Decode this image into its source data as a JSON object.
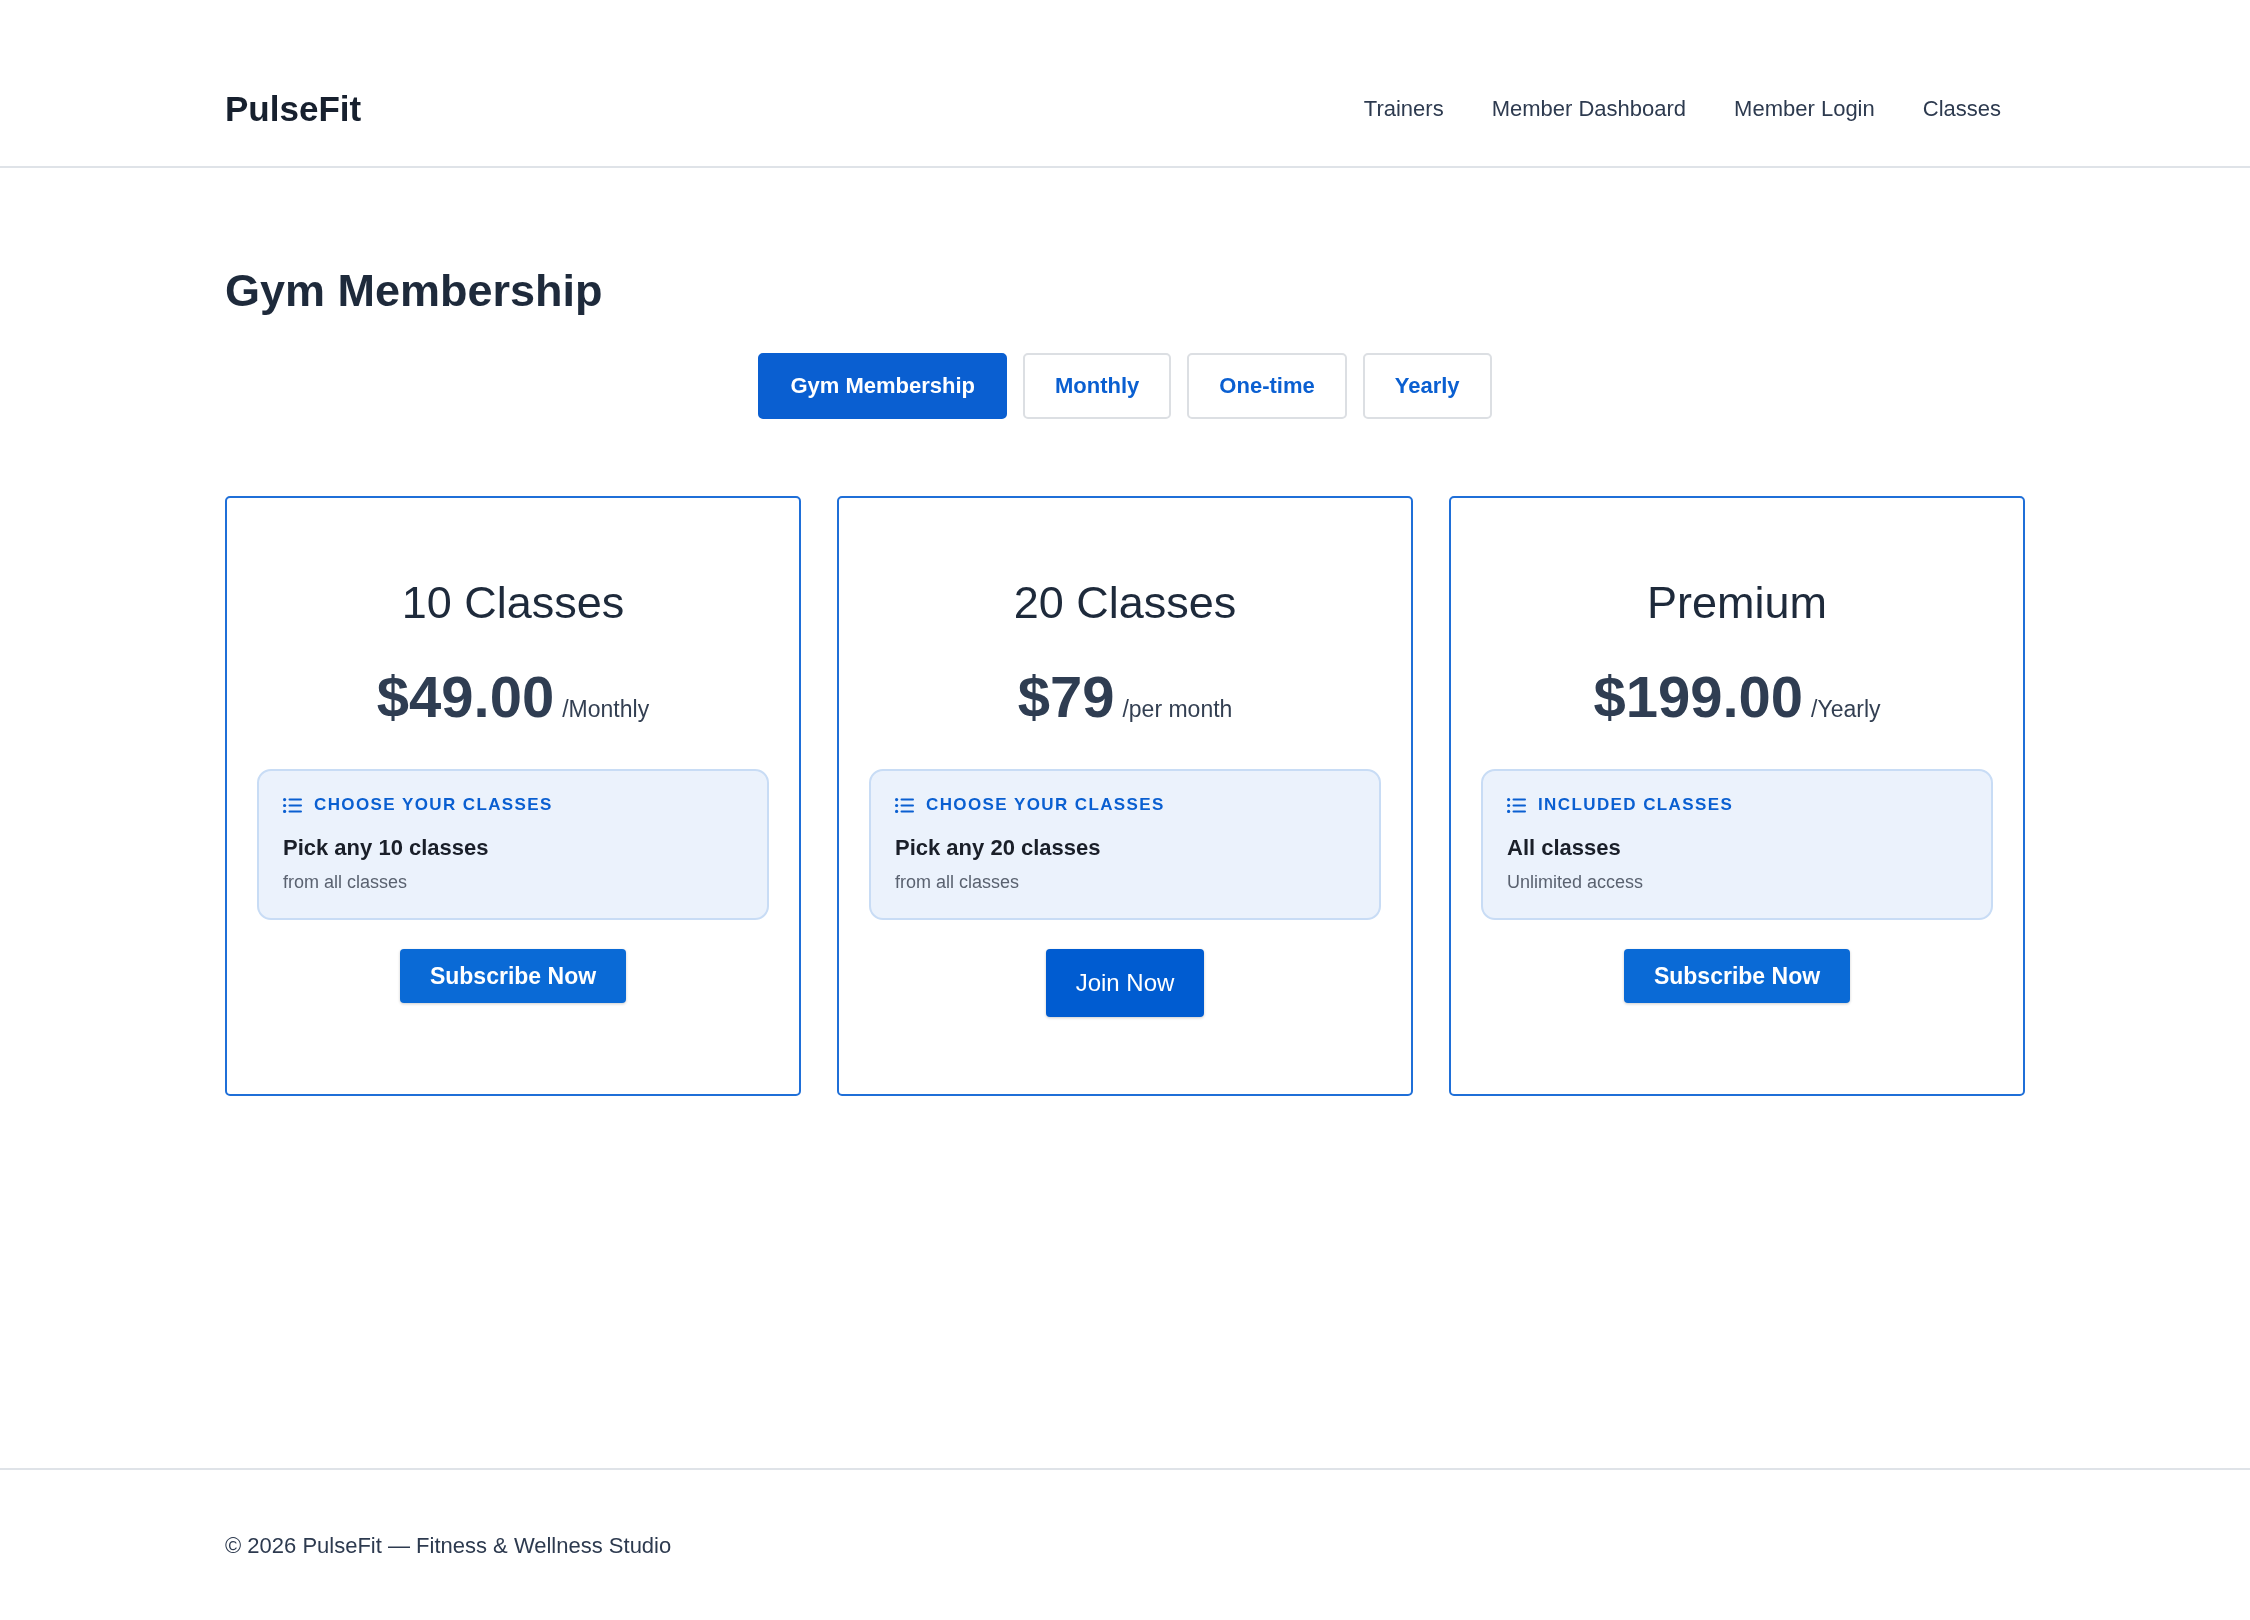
{
  "header": {
    "logo": "PulseFit",
    "nav": [
      "Trainers",
      "Member Dashboard",
      "Member Login",
      "Classes"
    ]
  },
  "page": {
    "title": "Gym Membership"
  },
  "tabs": [
    {
      "label": "Gym Membership",
      "selected": true
    },
    {
      "label": "Monthly",
      "selected": false
    },
    {
      "label": "One-time",
      "selected": false
    },
    {
      "label": "Yearly",
      "selected": false
    }
  ],
  "plans": [
    {
      "name": "10 Classes",
      "price": "$49.00",
      "period": "/Monthly",
      "info": {
        "heading": "CHOOSE YOUR CLASSES",
        "title": "Pick any 10 classes",
        "note": "from all classes"
      },
      "button": {
        "label": "Subscribe Now",
        "kind": "compact"
      }
    },
    {
      "name": "20 Classes",
      "price": "$79",
      "period": "/per month",
      "info": {
        "heading": "CHOOSE YOUR CLASSES",
        "title": "Pick any 20 classes",
        "note": "from all classes"
      },
      "button": {
        "label": "Join Now",
        "kind": "large"
      }
    },
    {
      "name": "Premium",
      "price": "$199.00",
      "period": "/Yearly",
      "info": {
        "heading": "INCLUDED CLASSES",
        "title": "All classes",
        "note": "Unlimited access"
      },
      "button": {
        "label": "Subscribe Now",
        "kind": "compact"
      }
    }
  ],
  "footer": {
    "text": "© 2026 PulseFit — Fitness & Wellness Studio"
  }
}
